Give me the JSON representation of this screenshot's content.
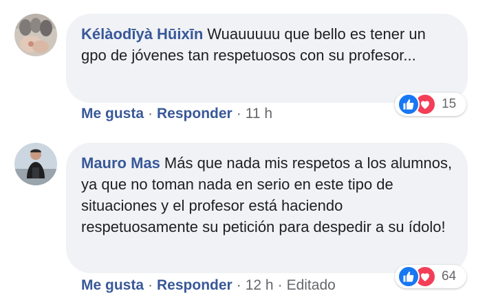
{
  "comments": [
    {
      "author": "Kélàodīyà Hūixīn",
      "text": "Wuauuuuu que bello es tener un gpo de jóvenes tan respetuosos con su profesor...",
      "reaction_count": "15",
      "actions": {
        "like": "Me gusta",
        "reply": "Responder",
        "time": "11 h"
      }
    },
    {
      "author": "Mauro Mas",
      "text": "Más que nada mis respetos a los alumnos, ya que no toman nada en serio en este tipo de situaciones y el profesor está haciendo respetuosamente su petición para despedir a su ídolo!",
      "reaction_count": "64",
      "actions": {
        "like": "Me gusta",
        "reply": "Responder",
        "time": "12 h",
        "edited": "Editado"
      }
    }
  ],
  "separator": "·",
  "colors": {
    "author": "#385898",
    "bubble": "#f0f2f5",
    "like": "#1877f2",
    "love": "#f33e58",
    "meta": "#65676b"
  },
  "icons": [
    "like-reaction-icon",
    "love-reaction-icon"
  ]
}
